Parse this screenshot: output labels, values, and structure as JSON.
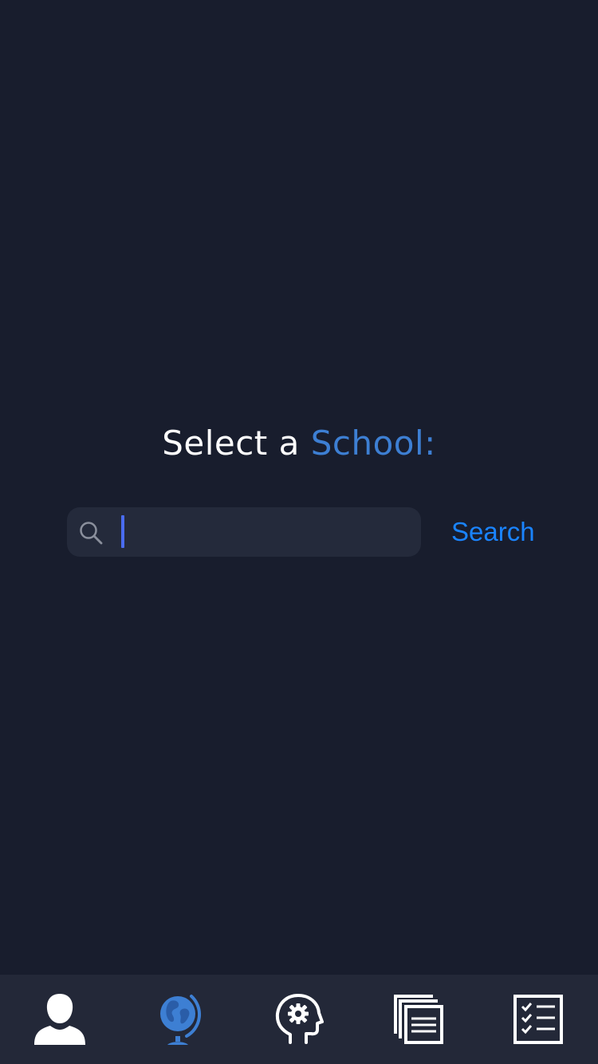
{
  "heading": {
    "prefix": "Select a",
    "accent": "School:"
  },
  "search": {
    "value": "",
    "placeholder": "",
    "button_label": "Search"
  },
  "tabbar": {
    "tabs": [
      {
        "icon": "profile-icon",
        "active": false
      },
      {
        "icon": "globe-icon",
        "active": true
      },
      {
        "icon": "mind-gear-icon",
        "active": false
      },
      {
        "icon": "documents-icon",
        "active": false
      },
      {
        "icon": "checklist-icon",
        "active": false
      }
    ]
  },
  "colors": {
    "background": "#181d2d",
    "accent": "#3d7fd3",
    "link": "#1a84ff",
    "tabbar": "#232838",
    "input": "#242a3b",
    "caret": "#4a6cf0"
  }
}
